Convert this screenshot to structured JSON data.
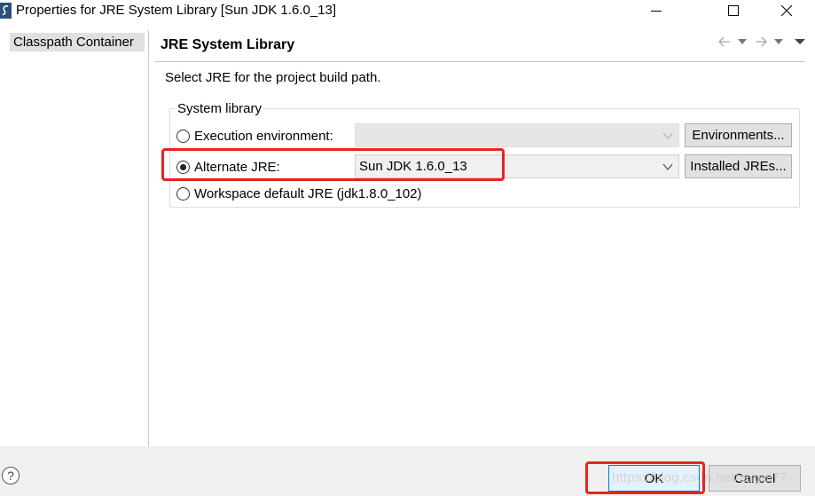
{
  "window": {
    "title": "Properties for JRE System Library [Sun JDK 1.6.0_13]",
    "controls": [
      "minimize-icon",
      "maximize-icon",
      "close-icon"
    ]
  },
  "sidebar": {
    "items": [
      {
        "label": "Classpath Container",
        "selected": true
      }
    ]
  },
  "page": {
    "title": "JRE System Library",
    "header_icons": [
      "back-icon",
      "back-menu-icon",
      "forward-icon",
      "forward-menu-icon",
      "view-menu-icon"
    ],
    "description": "Select JRE for the project build path.",
    "group": {
      "title": "System library",
      "options": {
        "execution_environment": {
          "label": "Execution environment:",
          "selected": false,
          "combo_value": "",
          "button": "Environments..."
        },
        "alternate_jre": {
          "label": "Alternate JRE:",
          "selected": true,
          "combo_value": "Sun JDK 1.6.0_13",
          "button": "Installed JREs..."
        },
        "workspace_default": {
          "label": "Workspace default JRE (jdk1.8.0_102)",
          "selected": false
        }
      }
    }
  },
  "footer": {
    "help_icon": "?",
    "ok_label": "OK",
    "cancel_label": "Cancel",
    "watermark": "https://blog.csdn.net/qugui77"
  },
  "colors": {
    "highlight": "#e8231e",
    "default_button_border": "#0078d7",
    "panel_bg": "#f0f0f0"
  }
}
